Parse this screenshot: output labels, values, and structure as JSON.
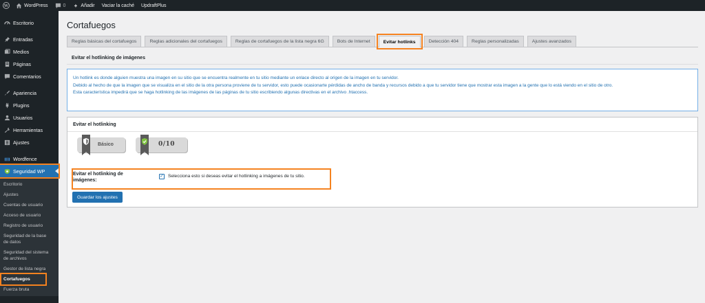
{
  "adminbar": {
    "site_name": "WordPress",
    "comments_count": "0",
    "new_label": "Añadir",
    "cache_label": "Vaciar la caché",
    "updraft_label": "UpdraftPlus"
  },
  "sidebar": {
    "items": [
      {
        "label": "Escritorio",
        "icon": "dashboard-icon"
      },
      {
        "label": "Entradas",
        "icon": "pin-icon"
      },
      {
        "label": "Medios",
        "icon": "media-icon"
      },
      {
        "label": "Páginas",
        "icon": "pages-icon"
      },
      {
        "label": "Comentarios",
        "icon": "comments-icon"
      },
      {
        "label": "Apariencia",
        "icon": "brush-icon"
      },
      {
        "label": "Plugins",
        "icon": "plugin-icon"
      },
      {
        "label": "Usuarios",
        "icon": "users-icon"
      },
      {
        "label": "Herramientas",
        "icon": "wrench-icon"
      },
      {
        "label": "Ajustes",
        "icon": "settings-icon"
      },
      {
        "label": "Wordfence",
        "icon": "wordfence-icon"
      },
      {
        "label": "Seguridad WP",
        "icon": "shield-icon"
      }
    ],
    "submenu": [
      "Escritorio",
      "Ajustes",
      "Cuentas de usuario",
      "Acceso de usuario",
      "Registro de usuario",
      "Seguridad de la base de datos",
      "Seguridad del sistema de archivos",
      "Gestor de lista negra",
      "Cortafuegos",
      "Fuerza bruta"
    ]
  },
  "page": {
    "title": "Cortafuegos",
    "tabs": [
      "Reglas básicas del cortafuegos",
      "Reglas adicionales del cortafuegos",
      "Reglas de cortafuegos de la lista negra 6G",
      "Bots de Internet",
      "Evitar hotlinks",
      "Detección 404",
      "Reglas personalizadas",
      "Ajustes avanzados"
    ],
    "active_tab": "Evitar hotlinks",
    "section_title": "Evitar el hotlinking de imágenes",
    "info_lines": [
      "Un hotlink es donde alguien muestra una imagen en su sitio que se encuentra realmente en tu sitio mediante un enlace directo al origen de la imagen en tu servidor.",
      "Debido al hecho de que la imagen que se visualiza en el sitio de la otra persona proviene de tu servidor, esto puede ocasionarte pérdidas de ancho de banda y recursos debido a que tu servidor tiene que mostrar esta imagen a la gente que lo está viendo en el sitio de otro.",
      "Esta característica impedirá que se haga hotlinking de las imágenes de las páginas de tu sitio escribiendo algunas directivas en el archivo .htaccess."
    ],
    "panel": {
      "title": "Evitar el hotlinking",
      "badge_level": "Básico",
      "score": "0/10",
      "option_label": "Evitar el hotlinking de imágenes:",
      "option_checked": true,
      "option_desc": "Selecciona esto si deseas evitar el hotlinking a imágenes de tu sitio.",
      "save_button": "Guardar los ajustes"
    }
  },
  "colors": {
    "admin_dark": "#1d2327",
    "accent_blue": "#2271b1",
    "highlight_orange": "#f5821f",
    "info_text": "#2271b1"
  }
}
